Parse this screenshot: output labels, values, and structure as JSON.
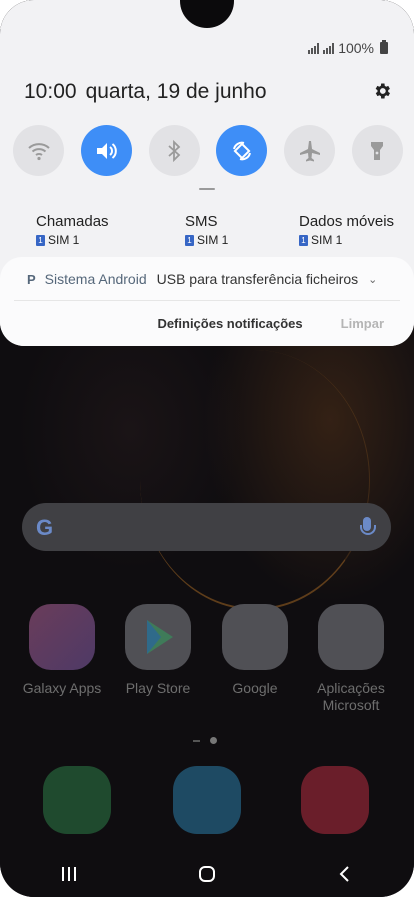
{
  "status_bar": {
    "battery_text": "100%"
  },
  "shade": {
    "time": "10:00",
    "date": "quarta, 19 de junho",
    "toggles": [
      {
        "icon": "wifi-icon",
        "active": false
      },
      {
        "icon": "sound-icon",
        "active": true
      },
      {
        "icon": "bluetooth-icon",
        "active": false
      },
      {
        "icon": "auto-rotate-icon",
        "active": true
      },
      {
        "icon": "airplane-icon",
        "active": false
      },
      {
        "icon": "flashlight-icon",
        "active": false
      }
    ],
    "sims": [
      {
        "title": "Chamadas",
        "badge": "1",
        "sim": "SIM 1"
      },
      {
        "title": "SMS",
        "badge": "1",
        "sim": "SIM 1"
      },
      {
        "title": "Dados móveis",
        "badge": "1",
        "sim": "SIM 1"
      }
    ]
  },
  "notification": {
    "app_icon_letter": "P",
    "app_name": "Sistema Android",
    "message": "USB para transferência ficheiros",
    "settings_label": "Definições notificações",
    "clear_label": "Limpar"
  },
  "home": {
    "apps": [
      {
        "label": "Galaxy Apps"
      },
      {
        "label": "Play Store"
      },
      {
        "label": "Google"
      },
      {
        "label": "Aplicações Microsoft"
      }
    ]
  },
  "colors": {
    "accent": "#3e8ef7",
    "shade_bg": "#f2f2f4"
  }
}
